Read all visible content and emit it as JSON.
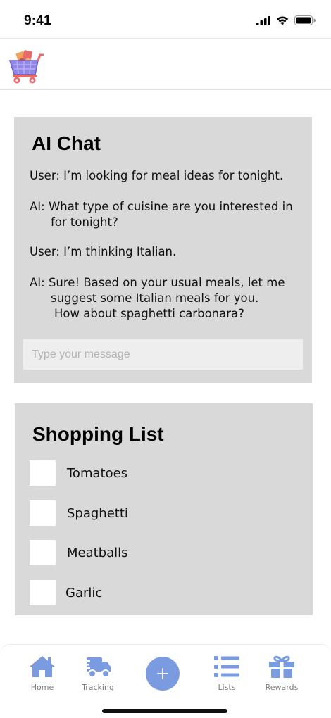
{
  "status_bar": {
    "time": "9:41",
    "icons": [
      "cellular-signal-icon",
      "wifi-icon",
      "battery-icon"
    ]
  },
  "header": {
    "logo_icon": "shopping-cart-logo-icon"
  },
  "chat": {
    "title": "AI Chat",
    "messages": [
      {
        "line1": "User: I’m looking for meal ideas for tonight."
      },
      {
        "line1": "AI: What type of cuisine are you interested in",
        "line2": "for tonight?"
      },
      {
        "line1": "User: I’m thinking Italian."
      },
      {
        "line1": "AI: Sure! Based on your usual meals, let me",
        "line2": "suggest some Italian meals for you.",
        "line3": "How about spaghetti carbonara?"
      }
    ],
    "input_placeholder": "Type your message",
    "input_value": ""
  },
  "shopping_list": {
    "title": "Shopping List",
    "items": [
      {
        "label": "Tomatoes",
        "checked": false
      },
      {
        "label": "Spaghetti",
        "checked": false
      },
      {
        "label": "Meatballs",
        "checked": false
      },
      {
        "label": "Garlic",
        "checked": false
      }
    ]
  },
  "bottom_nav": {
    "items": [
      {
        "label": "Home",
        "icon": "home-icon"
      },
      {
        "label": "Tracking",
        "icon": "delivery-truck-icon"
      },
      {
        "label": "",
        "icon": "plus-icon"
      },
      {
        "label": "Lists",
        "icon": "list-icon"
      },
      {
        "label": "Rewards",
        "icon": "gift-icon"
      }
    ]
  },
  "colors": {
    "accent": "#7b9be0",
    "card_bg": "#d9d9d9",
    "input_bg": "#eeeeee"
  }
}
